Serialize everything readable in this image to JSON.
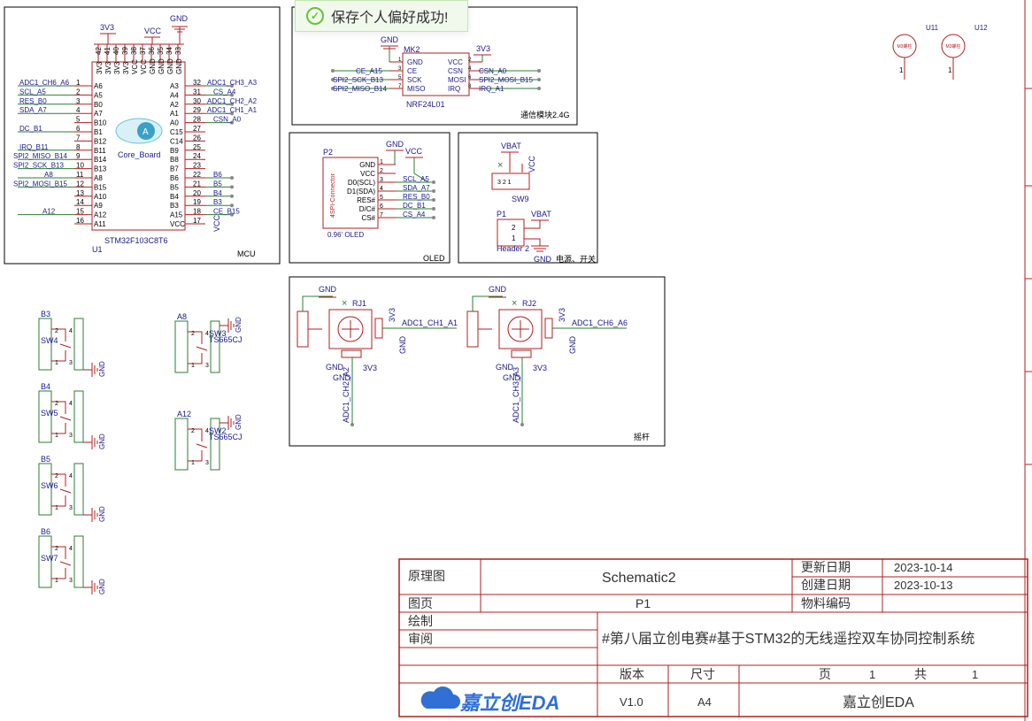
{
  "toast": {
    "message": "保存个人偏好成功!"
  },
  "mcu": {
    "frame_label": "MCU",
    "ref": "U1",
    "part": "STM32F103C8T6",
    "logo_text": "Core_Board",
    "power_3v3": "3V3",
    "power_vcc": "VCC",
    "power_gnd": "GND",
    "top_pin_numbers": [
      "42",
      "41",
      "40",
      "39",
      "38",
      "37",
      "36",
      "35",
      "34",
      "33"
    ],
    "top_pin_names": [
      "3V3",
      "3V3",
      "3V3",
      "3V3",
      "VCC",
      "VCC",
      "GND",
      "GND",
      "GND",
      "GND"
    ],
    "left_pins": [
      {
        "net": "ADC1_CH6_A6",
        "num": "1",
        "name": "A6"
      },
      {
        "net": "SCL_A5",
        "num": "2",
        "name": "A5"
      },
      {
        "net": "RES_B0",
        "num": "3",
        "name": "B0"
      },
      {
        "net": "SDA_A7",
        "num": "4",
        "name": "A7"
      },
      {
        "net": "",
        "num": "5",
        "name": "B10"
      },
      {
        "net": "DC_B1",
        "num": "6",
        "name": "B1"
      },
      {
        "net": "",
        "num": "7",
        "name": "B12"
      },
      {
        "net": "IRQ_B11",
        "num": "8",
        "name": "B11"
      },
      {
        "net": "SPI2_MISO_B14",
        "num": "9",
        "name": "B14"
      },
      {
        "net": "SPI2_SCK_B13",
        "num": "10",
        "name": "B13"
      },
      {
        "net": "A8",
        "num": "11",
        "name": "A8"
      },
      {
        "net": "SPI2_MOSI_B15",
        "num": "12",
        "name": "B15"
      },
      {
        "net": "",
        "num": "13",
        "name": "A10"
      },
      {
        "net": "",
        "num": "14",
        "name": "A9"
      },
      {
        "net": "A12",
        "num": "15",
        "name": "A12"
      },
      {
        "net": "",
        "num": "16",
        "name": "A11"
      }
    ],
    "right_pins": [
      {
        "net": "ADC1_CH3_A3",
        "num": "32",
        "name": "A3"
      },
      {
        "net": "CS_A4",
        "num": "31",
        "name": "A4"
      },
      {
        "net": "ADC1_CH2_A2",
        "num": "30",
        "name": "A2"
      },
      {
        "net": "ADC1_CH1_A1",
        "num": "29",
        "name": "A1"
      },
      {
        "net": "CSN_A0",
        "num": "28",
        "name": "A0"
      },
      {
        "net": "",
        "num": "27",
        "name": "C15"
      },
      {
        "net": "",
        "num": "26",
        "name": "C14"
      },
      {
        "net": "",
        "num": "25",
        "name": "B9"
      },
      {
        "net": "",
        "num": "24",
        "name": "B8"
      },
      {
        "net": "",
        "num": "23",
        "name": "B7"
      },
      {
        "net": "B6",
        "num": "22",
        "name": "B6"
      },
      {
        "net": "B5",
        "num": "21",
        "name": "B5"
      },
      {
        "net": "B4",
        "num": "20",
        "name": "B4"
      },
      {
        "net": "B3",
        "num": "19",
        "name": "B3"
      },
      {
        "net": "CE_B15",
        "num": "18",
        "name": "A15"
      },
      {
        "net": "",
        "num": "17",
        "name": "VCC"
      }
    ],
    "vcc_bottom": "VCC"
  },
  "radio": {
    "frame_label": "通信模块2.4G",
    "ref": "MK2",
    "part": "NRF24L01",
    "gnd": "GND",
    "v3": "3V3",
    "left_pins": [
      {
        "net": "",
        "num": "1",
        "name": "GND"
      },
      {
        "net": "CE_A15",
        "num": "3",
        "name": "CE"
      },
      {
        "net": "SPI2_SCK_B13",
        "num": "5",
        "name": "SCK"
      },
      {
        "net": "SPI2_MISO_B14",
        "num": "7",
        "name": "MISO"
      }
    ],
    "right_pins": [
      {
        "net": "",
        "num": "2",
        "name": "VCC"
      },
      {
        "net": "CSN_A0",
        "num": "4",
        "name": "CSN"
      },
      {
        "net": "SPI2_MOSI_B15",
        "num": "6",
        "name": "MOSI"
      },
      {
        "net": "IRQ_A1",
        "num": "8",
        "name": "IRQ"
      }
    ]
  },
  "oled": {
    "frame_label": "OLED",
    "ref": "P2",
    "part": "0.96' OLED",
    "connector_text": "4SPI-Connector",
    "gnd": "GND",
    "vcc": "VCC",
    "pins": [
      {
        "name": "GND",
        "num": "1",
        "net": ""
      },
      {
        "name": "VCC",
        "num": "2",
        "net": ""
      },
      {
        "name": "D0(SCL)",
        "num": "3",
        "net": "SCL_A5"
      },
      {
        "name": "D1(SDA)",
        "num": "4",
        "net": "SDA_A7"
      },
      {
        "name": "RES#",
        "num": "5",
        "net": "RES_B0"
      },
      {
        "name": "D/C#",
        "num": "6",
        "net": "DC_B1"
      },
      {
        "name": "CS#",
        "num": "7",
        "net": "CS_A4"
      }
    ]
  },
  "power": {
    "frame_label": "电源、开关",
    "vbat1": "VBAT",
    "vcc": "VCC",
    "sw_ref": "SW9",
    "sw_pins": "3 2 1",
    "header_ref": "P1",
    "header_part": "Header 2",
    "vbat2": "VBAT",
    "gnd": "GND",
    "pin2": "2",
    "pin1": "1"
  },
  "joystick": {
    "frame_label": "摇杆",
    "units": [
      {
        "ref": "RJ1",
        "gnd": "GND",
        "gnd2": "GND",
        "gnd3": "GND",
        "v3a": "3V3",
        "v3b": "3V3",
        "gnd_r": "GND",
        "net_right": "ADC1_CH1_A1",
        "net_bottom": "ADC1_CH2_A2"
      },
      {
        "ref": "RJ2",
        "gnd": "GND",
        "gnd2": "GND",
        "gnd3": "GND",
        "v3a": "3V3",
        "v3b": "3V3",
        "gnd_r": "GND",
        "net_right": "ADC1_CH6_A6",
        "net_bottom": "ADC1_CH3_A3"
      }
    ]
  },
  "switches": [
    {
      "net": "B3",
      "ref": "SW4",
      "gnd": "GND",
      "p1": "2",
      "p2": "1",
      "p3": "4",
      "p4": "3"
    },
    {
      "net": "B4",
      "ref": "SW5",
      "gnd": "GND",
      "p1": "2",
      "p2": "1",
      "p3": "4",
      "p4": "3"
    },
    {
      "net": "B5",
      "ref": "SW6",
      "gnd": "GND",
      "p1": "2",
      "p2": "1",
      "p3": "4",
      "p4": "3"
    },
    {
      "net": "B6",
      "ref": "SW7",
      "gnd": "GND",
      "p1": "2",
      "p2": "1",
      "p3": "4",
      "p4": "3"
    },
    {
      "net": "A8",
      "ref": "SW3",
      "part": "TS665CJ",
      "gnd": "GND",
      "p1": "2",
      "p2": "1",
      "p3": "4",
      "p4": "3"
    },
    {
      "net": "A12",
      "ref": "SW2",
      "part": "TS665CJ",
      "gnd": "GND",
      "p1": "2",
      "p2": "1",
      "p3": "4",
      "p4": "3"
    }
  ],
  "motors": [
    {
      "ref": "U11",
      "label": "M3螺柱"
    },
    {
      "ref": "U12",
      "label": "M3螺柱"
    }
  ],
  "title_block": {
    "label_schematic": "原理图",
    "title": "Schematic2",
    "label_update": "更新日期",
    "update_date": "2023-10-14",
    "label_create": "创建日期",
    "create_date": "2023-10-13",
    "label_page": "图页",
    "page": "P1",
    "label_material": "物料编码",
    "label_draw": "绘制",
    "label_review": "审阅",
    "project": "#第八届立创电赛#基于STM32的无线遥控双车协同控制系统",
    "label_version": "版本",
    "label_size": "尺寸",
    "label_pg": "页",
    "pg_num": "1",
    "label_total": "共",
    "total": "1",
    "logo": "嘉立创EDA",
    "version": "V1.0",
    "size": "A4",
    "company": "嘉立创EDA"
  },
  "colors": {
    "wire": "#2e7d32",
    "part": "#b11f1f",
    "text": "#1a1a8c",
    "frame": "#000000",
    "pin": "#888888"
  }
}
